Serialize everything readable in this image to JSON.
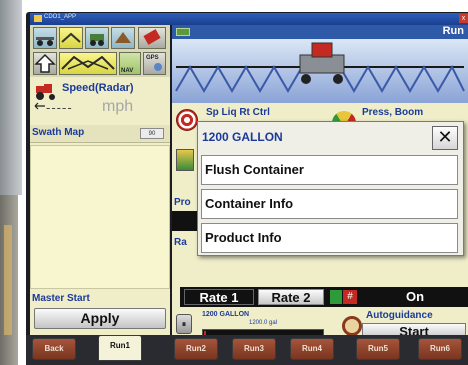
{
  "titlebar": {
    "app_title": "CDO1_APP",
    "close": "x"
  },
  "left_panel": {
    "speed_label": "Speed(Radar)",
    "speed_value": "-----",
    "speed_unit": "mph",
    "swath_label": "Swath Map",
    "swath_zoom": "90",
    "nav_label": "NAV",
    "gps_label": "GPS",
    "master_start_label": "Master Start",
    "apply_label": "Apply"
  },
  "right_panel": {
    "header_run": "Run",
    "sp_liq_label": "Sp Liq Rt Ctrl",
    "press_boom_label": "Press, Boom",
    "pro_fragment": "Pro",
    "ra_fragment": "Ra",
    "rate1_label": "Rate 1",
    "rate2_label": "Rate 2",
    "on_label": "On",
    "container_name": "1200 GALLON",
    "container_gal": "1200.0 gal",
    "container_fill_pct": 1,
    "autoguidance_label": "Autoguidance",
    "start_label": "Start"
  },
  "modal": {
    "title": "1200 GALLON",
    "close_label": "✕",
    "options": [
      "Flush Container",
      "Container Info",
      "Product Info"
    ]
  },
  "tabs": [
    "Back",
    "Run1",
    "Run2",
    "Run3",
    "Run4",
    "Run5",
    "Run6"
  ],
  "active_tab": "Run1",
  "colors": {
    "label_blue": "#1b3a9a",
    "panel_bg": "#efeec9",
    "tab_brown": "#8a3c24"
  }
}
